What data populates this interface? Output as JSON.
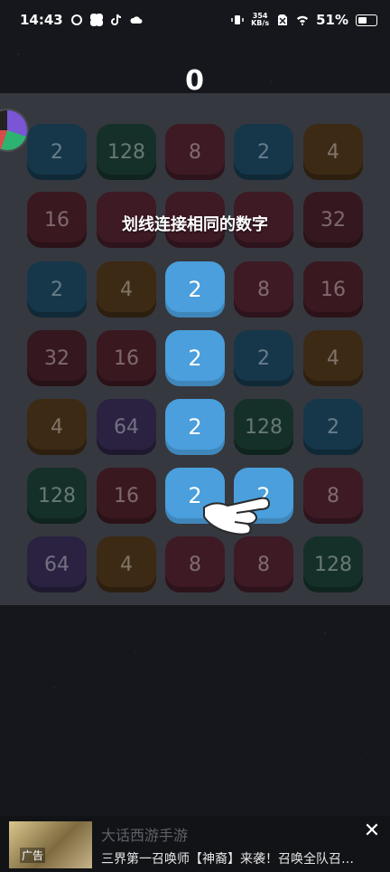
{
  "statusbar": {
    "time": "14:43",
    "net_speed_value": "354",
    "net_speed_unit": "KB/s",
    "battery": "51%"
  },
  "score": "0",
  "hint": "划线连接相同的数字",
  "grid": [
    [
      "2",
      "128",
      "8",
      "2",
      "4"
    ],
    [
      "16",
      "",
      "",
      "",
      "32"
    ],
    [
      "2",
      "4",
      "2",
      "8",
      "16"
    ],
    [
      "32",
      "16",
      "2",
      "2",
      "4"
    ],
    [
      "4",
      "64",
      "2",
      "128",
      "2"
    ],
    [
      "128",
      "16",
      "2",
      "2",
      "8"
    ],
    [
      "64",
      "4",
      "8",
      "8",
      "128"
    ]
  ],
  "colors": {
    "tile_2": "#16374a",
    "tile_4": "#3d2a15",
    "tile_8": "#3d1a24",
    "tile_16": "#3a1820",
    "tile_32": "#35181f",
    "tile_64": "#2a2240",
    "tile_128": "#153028",
    "tile_active": "#4a9fdc"
  },
  "ad": {
    "tag": "广告",
    "title": "大话西游手游",
    "subtitle": "三界第一召唤师【神裔】来袭！召唤全队召…"
  }
}
